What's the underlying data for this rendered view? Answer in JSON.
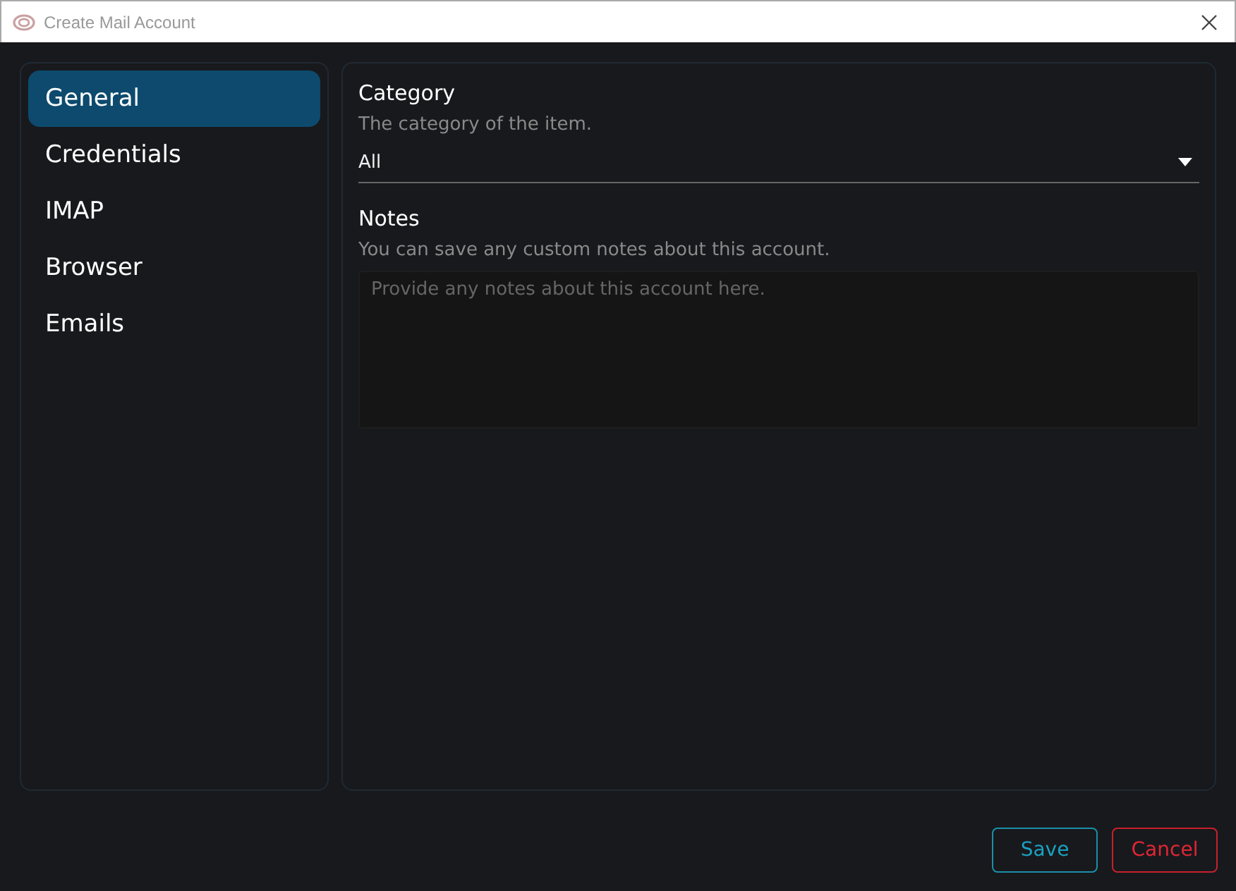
{
  "window": {
    "title": "Create Mail Account"
  },
  "sidebar": {
    "items": [
      {
        "label": "General",
        "selected": true
      },
      {
        "label": "Credentials",
        "selected": false
      },
      {
        "label": "IMAP",
        "selected": false
      },
      {
        "label": "Browser",
        "selected": false
      },
      {
        "label": "Emails",
        "selected": false
      }
    ]
  },
  "fields": [
    {
      "kind": "select",
      "label": "Category",
      "description": "The category of the item.",
      "value": "All"
    },
    {
      "kind": "textarea",
      "label": "Notes",
      "description": "You can save any custom notes about this account.",
      "placeholder": "Provide any notes about this account here."
    }
  ],
  "buttons": [
    {
      "label": "Save",
      "kind": "primary"
    },
    {
      "label": "Cancel",
      "kind": "danger"
    }
  ]
}
